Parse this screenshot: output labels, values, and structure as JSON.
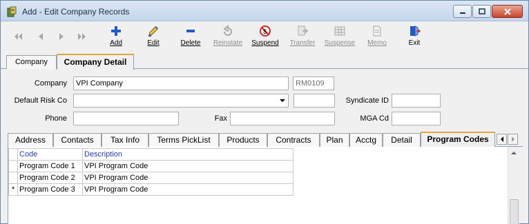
{
  "window": {
    "title": "Add - Edit Company Records"
  },
  "toolbar": {
    "buttons": [
      {
        "label": "Add",
        "enabled": true,
        "icon": "plus-icon"
      },
      {
        "label": "Edit",
        "enabled": true,
        "icon": "pencil-icon"
      },
      {
        "label": "Delete",
        "enabled": true,
        "icon": "minus-icon"
      },
      {
        "label": "Reinstate",
        "enabled": false,
        "icon": "reinstate-icon"
      },
      {
        "label": "Suspend",
        "enabled": true,
        "icon": "suspend-icon"
      },
      {
        "label": "Transfer",
        "enabled": false,
        "icon": "transfer-icon"
      },
      {
        "label": "Suspense",
        "enabled": false,
        "icon": "suspense-icon"
      },
      {
        "label": "Memo",
        "enabled": false,
        "icon": "memo-icon"
      },
      {
        "label": "Exit",
        "enabled": true,
        "icon": "exit-icon"
      }
    ]
  },
  "top_tabs": {
    "company": "Company",
    "company_detail": "Company Detail"
  },
  "form": {
    "company_label": "Company",
    "company_value": "VPI Company",
    "company_code": "RM0109",
    "default_risk_label": "Default Risk Co",
    "default_risk_value": "",
    "syndicate_label": "Syndicate ID",
    "syndicate_value": "",
    "phone_label": "Phone",
    "phone_value": "",
    "fax_label": "Fax",
    "fax_value": "",
    "mga_label": "MGA Cd",
    "mga_value": ""
  },
  "detail_tabs": {
    "address": "Address",
    "contacts": "Contacts",
    "tax_info": "Tax Info",
    "terms_picklist": "Terms PickList",
    "products": "Products",
    "contracts": "Contracts",
    "plan": "Plan",
    "acctg": "Acctg",
    "detail": "Detail",
    "program_codes": "Program Codes"
  },
  "grid": {
    "columns": {
      "code": "Code",
      "description": "Description"
    },
    "rows": [
      {
        "marker": "",
        "code": "Program Code 1",
        "description": "VPI Program Code"
      },
      {
        "marker": "",
        "code": "Program Code 2",
        "description": "VPI Program Code"
      },
      {
        "marker": "*",
        "code": "Program Code 3",
        "description": "VPI Program Code"
      }
    ]
  },
  "colors": {
    "accent_tab": "#e8a33b",
    "header_text": "#1f3ea3",
    "add_icon": "#1f5bc7",
    "suspend_icon": "#d22424"
  }
}
